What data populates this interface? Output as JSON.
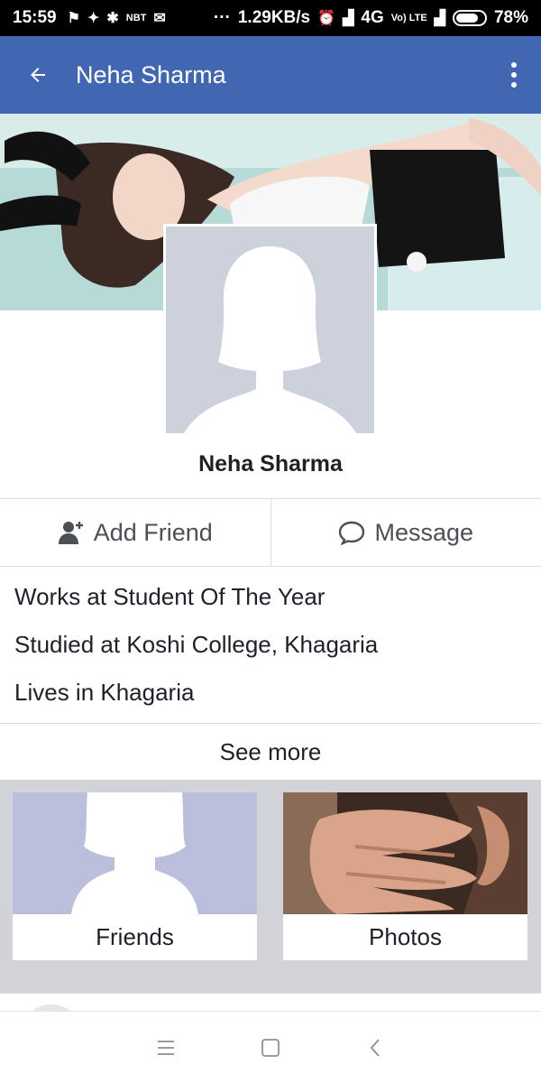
{
  "status_bar": {
    "time": "15:59",
    "net_badge": "NBT",
    "more": "···",
    "speed": "1.29KB/s",
    "network": "4G",
    "volte": "Vo) LTE",
    "battery": "78%",
    "battery_level": 0.78
  },
  "app_bar": {
    "back_icon": "back-arrow-icon",
    "title": "Neha Sharma",
    "menu_icon": "more-vert-icon"
  },
  "profile": {
    "name": "Neha Sharma"
  },
  "actions": {
    "add_friend": "Add Friend",
    "message": "Message"
  },
  "intro": [
    "Works at Student Of The Year",
    "Studied at Koshi College, Khagaria",
    "Lives in Khagaria"
  ],
  "see_more": "See more",
  "tiles": {
    "friends": "Friends",
    "photos": "Photos"
  },
  "colors": {
    "header": "#4267b2",
    "text": "#1d2129",
    "secondary_text": "#4b4f56",
    "divider": "#dddfe2"
  }
}
